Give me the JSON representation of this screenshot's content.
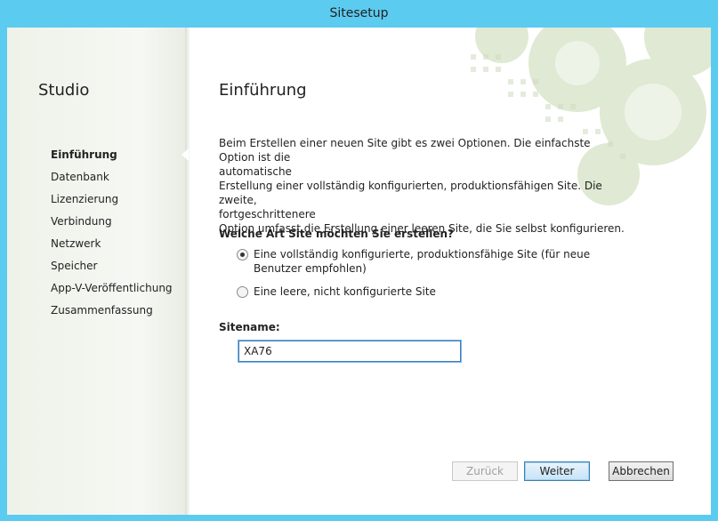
{
  "window": {
    "title": "Sitesetup"
  },
  "sidebar": {
    "app_name": "Studio",
    "items": [
      {
        "label": "Einführung"
      },
      {
        "label": "Datenbank"
      },
      {
        "label": "Lizenzierung"
      },
      {
        "label": "Verbindung"
      },
      {
        "label": "Netzwerk"
      },
      {
        "label": "Speicher"
      },
      {
        "label": "App-V-Veröffentlichung"
      },
      {
        "label": "Zusammenfassung"
      }
    ],
    "active_index": 0
  },
  "main": {
    "heading": "Einführung",
    "intro_lines": [
      "Beim Erstellen einer neuen Site gibt es zwei Optionen. Die einfachste Option ist die",
      "automatische",
      "Erstellung einer vollständig konfigurierten, produktionsfähigen Site. Die zweite,",
      "fortgeschrittenere",
      "Option umfasst die Erstellung einer leeren Site, die Sie selbst konfigurieren."
    ],
    "question": "Welche Art Site möchten Sie erstellen?",
    "options": [
      {
        "label": "Eine vollständig konfigurierte, produktionsfähige Site (für neue Benutzer empfohlen)",
        "selected": true
      },
      {
        "label": "Eine leere, nicht konfigurierte Site",
        "selected": false
      }
    ],
    "sitename_label": "Sitename:",
    "sitename_value": "XA76"
  },
  "buttons": {
    "back": "Zurück",
    "next": "Weiter",
    "cancel": "Abbrechen"
  },
  "colors": {
    "window_frame": "#5ccbf0",
    "sidebar_bg": "#f6f8f3",
    "decoration": "#d7e3c7",
    "input_border": "#3c7fb1"
  }
}
